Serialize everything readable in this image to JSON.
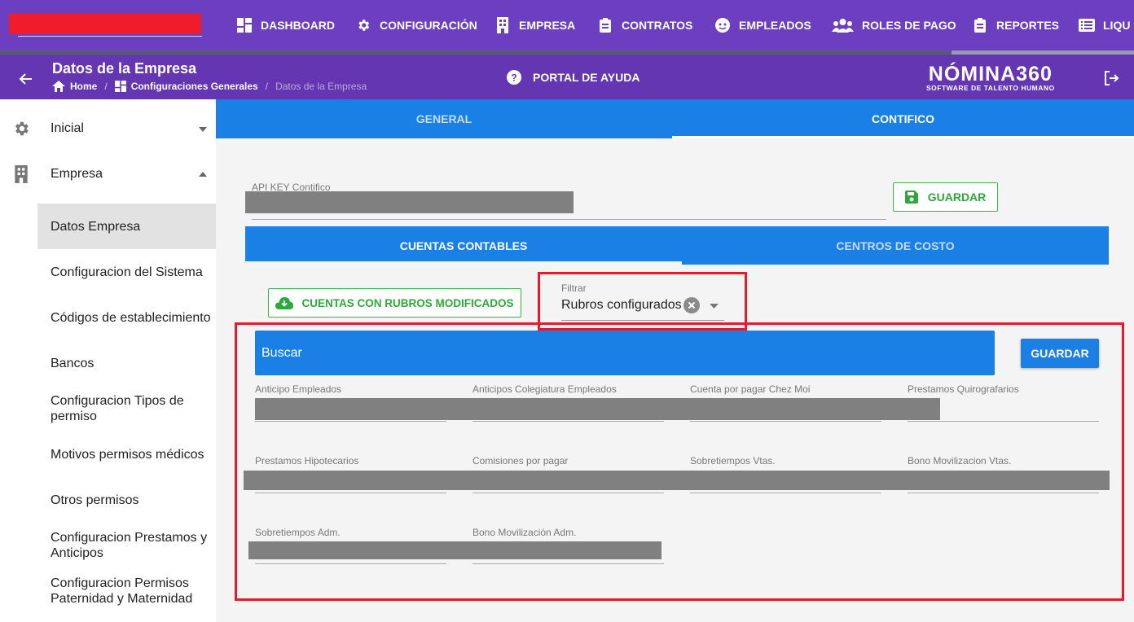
{
  "topnav": {
    "items": [
      {
        "label": "DASHBOARD",
        "icon": "dashboard-icon"
      },
      {
        "label": "CONFIGURACIÓN",
        "icon": "gear-icon"
      },
      {
        "label": "EMPRESA",
        "icon": "building-icon"
      },
      {
        "label": "CONTRATOS",
        "icon": "clipboard-icon"
      },
      {
        "label": "EMPLEADOS",
        "icon": "face-icon"
      },
      {
        "label": "ROLES DE PAGO",
        "icon": "users-icon"
      },
      {
        "label": "REPORTES",
        "icon": "clipboard-list-icon"
      },
      {
        "label": "LIQU",
        "icon": "list-icon"
      }
    ]
  },
  "header": {
    "title": "Datos de la Empresa",
    "breadcrumb": {
      "home": "Home",
      "section": "Configuraciones Generales",
      "current": "Datos de la Empresa",
      "separator": "/"
    },
    "help": "PORTAL DE AYUDA",
    "brand_name": "NÓMINA360",
    "brand_tagline": "SOFTWARE DE TALENTO HUMANO"
  },
  "sidebar": {
    "top_items": [
      {
        "label": "Inicial",
        "icon": "gear-icon",
        "expanded": false
      },
      {
        "label": "Empresa",
        "icon": "building-icon",
        "expanded": true
      }
    ],
    "sub_items": [
      "Datos Empresa",
      "Configuracion del Sistema",
      "Códigos de establecimiento",
      "Bancos",
      "Configuracion Tipos de permiso",
      "Motivos permisos médicos",
      "Otros permisos",
      "Configuracion Prestamos y Anticipos",
      "Configuracion Permisos Paternidad y Maternidad"
    ]
  },
  "main": {
    "tabs": [
      "GENERAL",
      "CONTIFICO"
    ],
    "active_tab": "CONTIFICO",
    "api_key_label": "API KEY Contifico",
    "save_label": "GUARDAR",
    "inner_tabs": [
      "CUENTAS CONTABLES",
      "CENTROS DE COSTO"
    ],
    "active_inner_tab": "CUENTAS CONTABLES",
    "cuentas_button": "CUENTAS CON RUBROS MODIFICADOS",
    "filter": {
      "label": "Filtrar",
      "value": "Rubros configurados"
    },
    "search_placeholder": "Buscar",
    "save2_label": "GUARDAR",
    "fields": [
      "Anticipo Empleados",
      "Anticipos Colegiatura Empleados",
      "Cuenta por pagar Chez Moi",
      "Prestamos Quirografarios",
      "Prestamos Hipotecarios",
      "Comisiones por pagar",
      "Sobretiempos Vtas.",
      "Bono Movilizacion Vtas.",
      "Sobretiempos Adm.",
      "Bono Movilización Adm."
    ]
  },
  "colors": {
    "topbar": "#6c3fc0",
    "subheader": "#6436b2",
    "primary": "#1a80e6",
    "success": "#2ea83c",
    "highlight": "#e8192c",
    "redaction": "#808080"
  }
}
